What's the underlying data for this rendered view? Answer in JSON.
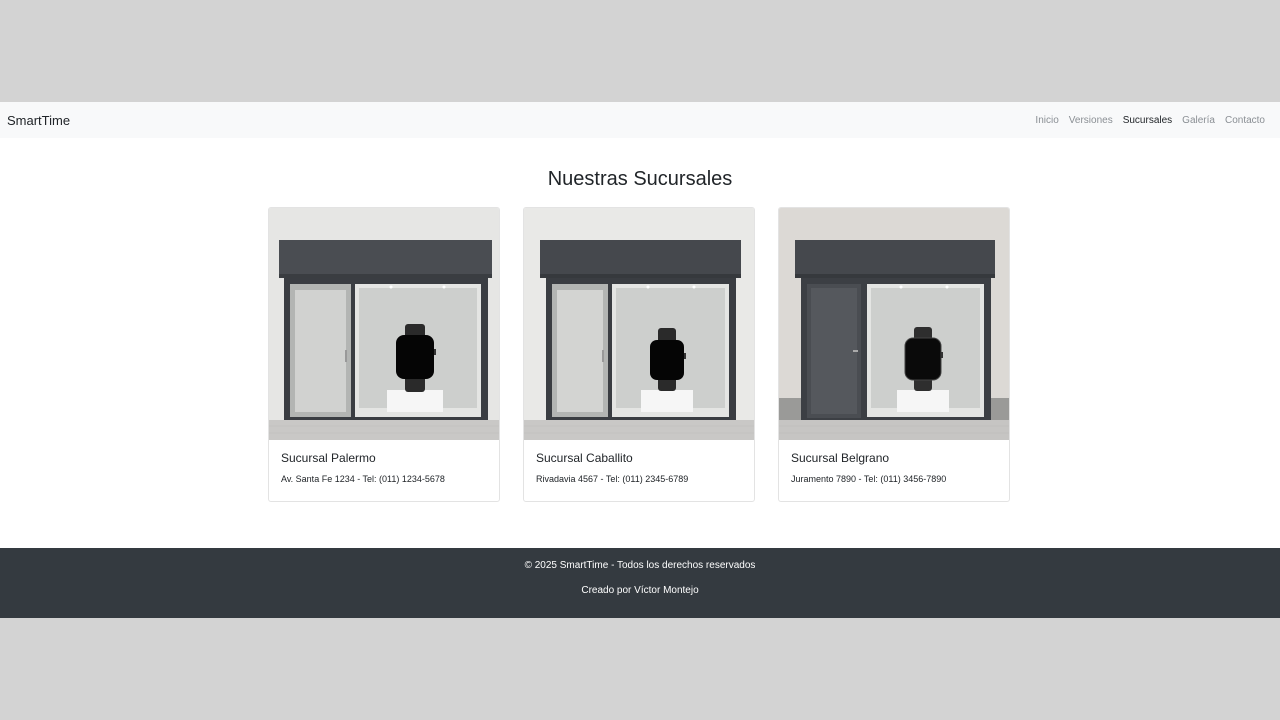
{
  "navbar": {
    "brand": "SmartTime",
    "links": [
      {
        "label": "Inicio"
      },
      {
        "label": "Versiones"
      },
      {
        "label": "Sucursales",
        "active": true
      },
      {
        "label": "Galería"
      },
      {
        "label": "Contacto"
      }
    ]
  },
  "main": {
    "title": "Nuestras Sucursales",
    "cards": [
      {
        "title": "Sucursal Palermo",
        "text": "Av. Santa Fe 1234 - Tel: (011) 1234-5678",
        "image": "storefront-image"
      },
      {
        "title": "Sucursal Caballito",
        "text": "Rivadavia 4567 - Tel: (011) 2345-6789",
        "image": "storefront-image"
      },
      {
        "title": "Sucursal Belgrano",
        "text": "Juramento 7890 - Tel: (011) 3456-7890",
        "image": "storefront-image"
      }
    ]
  },
  "footer": {
    "copyright": "© 2025 SmartTime - Todos los derechos reservados",
    "credit": "Creado por Víctor Montejo"
  },
  "colors": {
    "navbar_bg": "#f8f9fa",
    "footer_bg": "#343a40",
    "outer_bg": "#d3d3d3"
  }
}
